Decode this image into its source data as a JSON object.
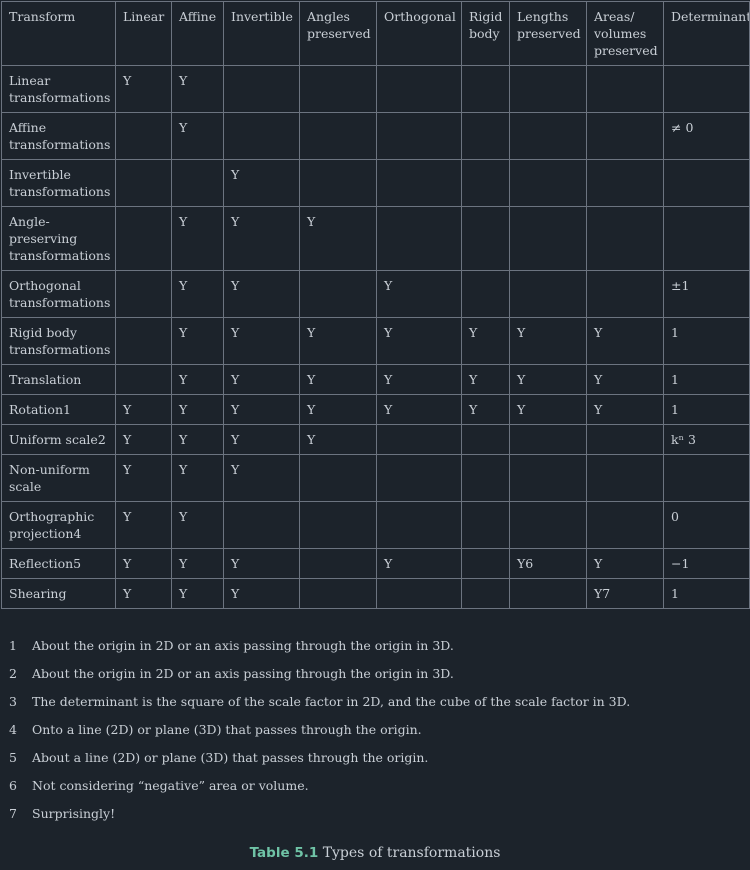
{
  "table": {
    "headers": [
      "Transform",
      "Linear",
      "Affine",
      "Invertible",
      "Angles preserved",
      "Orthogonal",
      "Rigid body",
      "Lengths preserved",
      "Areas/ volumes preserved",
      "Determinant"
    ],
    "rows": [
      {
        "name": "Linear transformations",
        "fn": "",
        "cells": [
          "Y",
          "Y",
          "",
          "",
          "",
          "",
          "",
          "",
          ""
        ]
      },
      {
        "name": "Affine transformations",
        "fn": "",
        "cells": [
          "",
          "Y",
          "",
          "",
          "",
          "",
          "",
          "",
          "≠ 0"
        ]
      },
      {
        "name": "Invertible transformations",
        "fn": "",
        "cells": [
          "",
          "",
          "Y",
          "",
          "",
          "",
          "",
          "",
          ""
        ]
      },
      {
        "name": "Angle-preserving transformations",
        "fn": "",
        "cells": [
          "",
          "Y",
          "Y",
          "Y",
          "",
          "",
          "",
          "",
          ""
        ]
      },
      {
        "name": "Orthogonal transformations",
        "fn": "",
        "cells": [
          "",
          "Y",
          "Y",
          "",
          "Y",
          "",
          "",
          "",
          "±1"
        ]
      },
      {
        "name": "Rigid body transformations",
        "fn": "",
        "cells": [
          "",
          "Y",
          "Y",
          "Y",
          "Y",
          "Y",
          "Y",
          "Y",
          "1"
        ]
      },
      {
        "name": "Translation",
        "fn": "",
        "cells": [
          "",
          "Y",
          "Y",
          "Y",
          "Y",
          "Y",
          "Y",
          "Y",
          "1"
        ]
      },
      {
        "name": "Rotation",
        "fn": "1",
        "cells": [
          "Y",
          "Y",
          "Y",
          "Y",
          "Y",
          "Y",
          "Y",
          "Y",
          "1"
        ]
      },
      {
        "name": "Uniform scale",
        "fn": "2",
        "cells": [
          "Y",
          "Y",
          "Y",
          "Y",
          "",
          "",
          "",
          "",
          "kⁿ  3"
        ]
      },
      {
        "name": "Non-uniform scale",
        "fn": "",
        "cells": [
          "Y",
          "Y",
          "Y",
          "",
          "",
          "",
          "",
          "",
          ""
        ]
      },
      {
        "name": "Orthographic projection",
        "fn": "4",
        "cells": [
          "Y",
          "Y",
          "",
          "",
          "",
          "",
          "",
          "",
          "0"
        ]
      },
      {
        "name": "Reflection",
        "fn": "5",
        "cells": [
          "Y",
          "Y",
          "Y",
          "",
          "Y",
          "",
          "Y6",
          "Y",
          "−1"
        ]
      },
      {
        "name": "Shearing",
        "fn": "",
        "cells": [
          "Y",
          "Y",
          "Y",
          "",
          "",
          "",
          "",
          "Y7",
          "1"
        ]
      }
    ]
  },
  "footnotes": [
    {
      "num": "1",
      "text": "About the origin in 2D or an axis passing through the origin in 3D."
    },
    {
      "num": "2",
      "text": "About the origin in 2D or an axis passing through the origin in 3D."
    },
    {
      "num": "3",
      "text": "The determinant is the square of the scale factor in 2D, and the cube of the scale factor in 3D."
    },
    {
      "num": "4",
      "text": "Onto a line (2D) or plane (3D) that passes through the origin."
    },
    {
      "num": "5",
      "text": "About a line (2D) or plane (3D) that passes through the origin."
    },
    {
      "num": "6",
      "text": "Not considering “negative” area or volume."
    },
    {
      "num": "7",
      "text": "Surprisingly!"
    }
  ],
  "caption": {
    "label": "Table 5.1",
    "text": "Types of transformations"
  },
  "colors": {
    "background": "#1c232b",
    "text": "#c9cfd6",
    "border": "#6c7480",
    "caption_label": "#6fc3a6"
  }
}
